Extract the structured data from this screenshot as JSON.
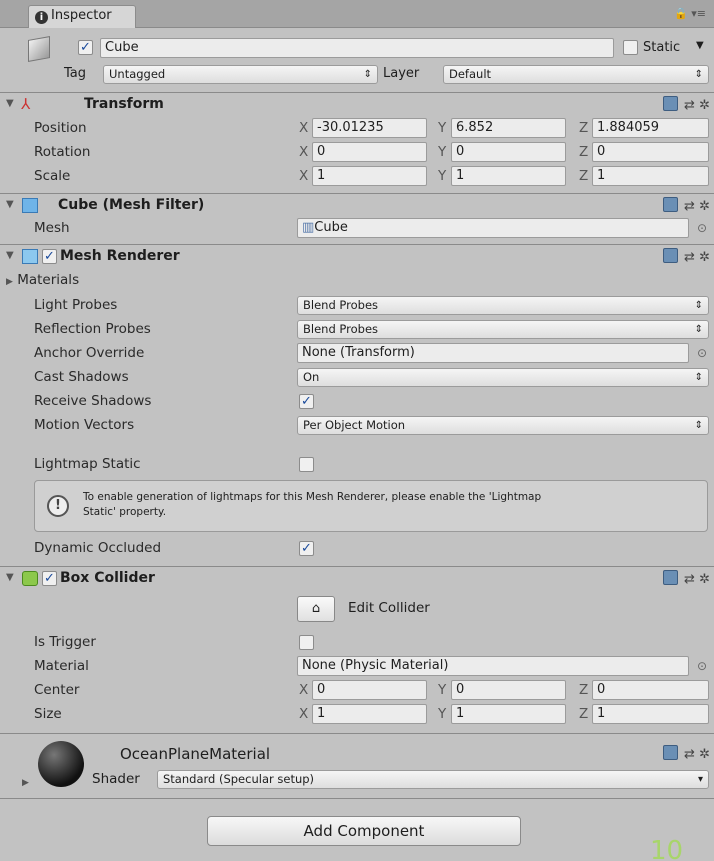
{
  "tab": {
    "title": "Inspector",
    "lock": "🔒 ▾≡"
  },
  "object": {
    "name": "Cube",
    "static_label": "Static",
    "tag_label": "Tag",
    "tag_value": "Untagged",
    "layer_label": "Layer",
    "layer_value": "Default"
  },
  "transform": {
    "title": "Transform",
    "position_label": "Position",
    "rotation_label": "Rotation",
    "scale_label": "Scale",
    "position": {
      "x": "-30.01235",
      "y": "6.852",
      "z": "1.884059"
    },
    "rotation": {
      "x": "0",
      "y": "0",
      "z": "0"
    },
    "scale": {
      "x": "1",
      "y": "1",
      "z": "1"
    }
  },
  "axes": {
    "x": "X",
    "y": "Y",
    "z": "Z"
  },
  "mesh_filter": {
    "title": "Cube (Mesh Filter)",
    "mesh_label": "Mesh",
    "mesh_value": "Cube"
  },
  "mesh_renderer": {
    "title": "Mesh Renderer",
    "materials_label": "Materials",
    "light_probes_label": "Light Probes",
    "light_probes_value": "Blend Probes",
    "reflection_probes_label": "Reflection Probes",
    "reflection_probes_value": "Blend Probes",
    "anchor_label": "Anchor Override",
    "anchor_value": "None (Transform)",
    "cast_label": "Cast Shadows",
    "cast_value": "On",
    "receive_label": "Receive Shadows",
    "motion_label": "Motion Vectors",
    "motion_value": "Per Object Motion",
    "lightmap_label": "Lightmap Static",
    "info_line1": "To enable generation of lightmaps for this Mesh Renderer, please enable the 'Lightmap",
    "info_line2": "Static' property.",
    "dynamic_label": "Dynamic Occluded"
  },
  "box_collider": {
    "title": "Box Collider",
    "edit_label": "Edit Collider",
    "trigger_label": "Is Trigger",
    "material_label": "Material",
    "material_value": "None (Physic Material)",
    "center_label": "Center",
    "size_label": "Size",
    "center": {
      "x": "0",
      "y": "0",
      "z": "0"
    },
    "size": {
      "x": "1",
      "y": "1",
      "z": "1"
    }
  },
  "material": {
    "name": "OceanPlaneMaterial",
    "shader_label": "Shader",
    "shader_value": "Standard (Specular setup)"
  },
  "add_component": "Add Component",
  "page_number": "10"
}
